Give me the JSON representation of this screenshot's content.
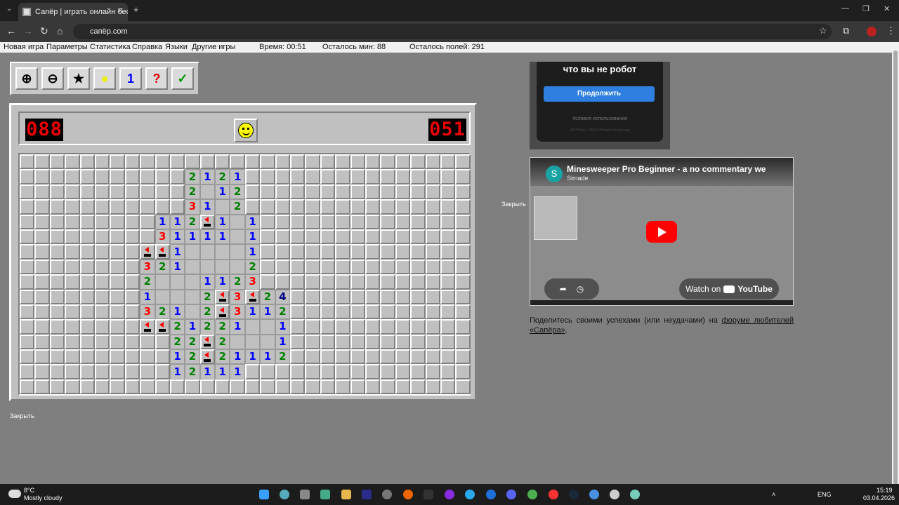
{
  "browser": {
    "tab_title": "Сапёр | играть онлайн беспла",
    "tab_close": "✕",
    "new_tab": "+",
    "url": "сапёр.com",
    "back": "←",
    "forward": "→",
    "reload": "↻",
    "home": "⌂",
    "window_min": "—",
    "window_max": "❐",
    "window_close": "✕"
  },
  "menu": {
    "new_game": "Новая игра",
    "params": "Параметры",
    "stats": "Статистика",
    "help": "Справка",
    "langs": "Языки",
    "other_games": "Другие игры",
    "time": "Время: 00:51",
    "mines_left": "Осталось мин: 88",
    "fields_left": "Осталось полей: 291"
  },
  "toolbar": {
    "zoom_in": "⊕",
    "zoom_out": "⊖",
    "star": "★",
    "hint": "💡",
    "numbers": "1",
    "help": "?",
    "check": "✓"
  },
  "game": {
    "mines_counter": "088",
    "time_counter": "051",
    "cols": 30,
    "rows": 16,
    "board": [
      "..............................",
      "...........2121...............",
      "...........2 12...............",
      "...........31 2...............",
      ".........112F1 1..............",
      ".........31111 1..............",
      "........FF1    1..............",
      "........321    2..............",
      "........2   1123..............",
      "........1   2F3F24............",
      "........321 2F3112............",
      "........FF21221  1............",
      "..........22F2   1............",
      "..........12F21112............",
      "..........12111...............",
      ".............................."
    ],
    "legend": {
      "dot": "unrevealed",
      "space": "empty",
      "F": "flag"
    }
  },
  "close_label_left": "Закрыть",
  "close_label_right": "Закрыть",
  "captcha": {
    "text": "что вы не робот",
    "button": "Продолжить",
    "terms": "Условия использования",
    "code": "t0KTfRdec...9WeO2tOqbdi 3m2lecaqq"
  },
  "video": {
    "title": "Minesweeper Pro Beginner - a no commentary we",
    "channel": "Simade",
    "avatar": "S",
    "watch_on": "Watch on",
    "youtube": "YouTube"
  },
  "share": {
    "text_before": "Поделитесь своими успехами (или неудачами) на ",
    "link": "форуме любителей «Сапёра»",
    "text_after": "."
  },
  "taskbar": {
    "temp": "8°C",
    "weather": "Mostly cloudy",
    "lang": "ENG",
    "time": "15:19",
    "date": "03.04.2026"
  }
}
